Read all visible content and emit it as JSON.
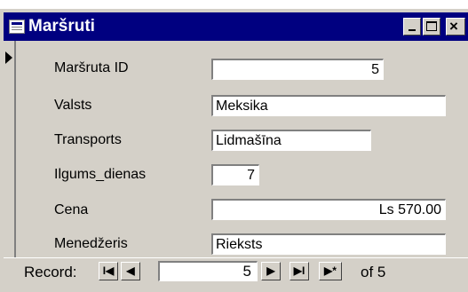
{
  "window": {
    "title": "Maršruti"
  },
  "fields": [
    {
      "label": "Maršruta ID",
      "value": "5"
    },
    {
      "label": "Valsts",
      "value": "Meksika"
    },
    {
      "label": "Transports",
      "value": "Lidmašīna"
    },
    {
      "label": "Ilgums_dienas",
      "value": "7"
    },
    {
      "label": "Cena",
      "value": "Ls 570.00"
    },
    {
      "label": "Menedžeris",
      "value": "Rieksts"
    }
  ],
  "navigation": {
    "label": "Record:",
    "current": "5",
    "of_text": "of 5",
    "buttons": {
      "first": "I◀",
      "prev": "◀",
      "next": "▶",
      "last": "▶I",
      "new": "▶*"
    }
  }
}
